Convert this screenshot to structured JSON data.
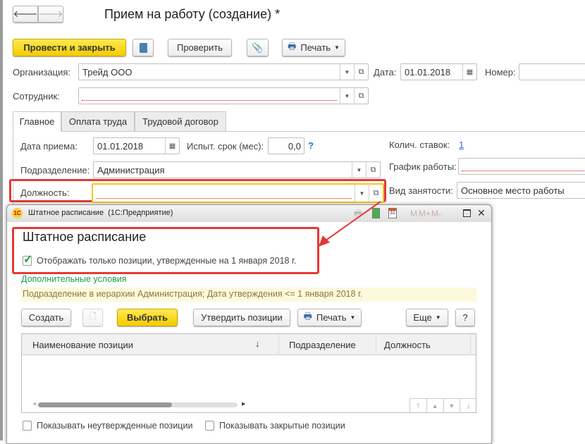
{
  "window": {
    "title": "Прием на работу (создание) *"
  },
  "toolbar": {
    "post_close": "Провести и закрыть",
    "check": "Проверить",
    "print": "Печать"
  },
  "form": {
    "org_label": "Организация:",
    "org_value": "Трейд ООО",
    "date_label": "Дата:",
    "date_value": "01.01.2018",
    "number_label": "Номер:",
    "number_value": "",
    "employee_label": "Сотрудник:",
    "employee_value": ""
  },
  "tabs": [
    "Главное",
    "Оплата труда",
    "Трудовой договор"
  ],
  "main": {
    "hire_date_label": "Дата приема:",
    "hire_date_value": "01.01.2018",
    "trial_label": "Испыт. срок (мес):",
    "trial_value": "0,0",
    "help": "?",
    "rates_label": "Колич. ставок:",
    "rates_value": "1",
    "dept_label": "Подразделение:",
    "dept_value": "Администрация",
    "schedule_label": "График работы:",
    "schedule_value": "",
    "position_label": "Должность:",
    "position_value": "",
    "employment_label": "Вид занятости:",
    "employment_value": "Основное место работы"
  },
  "popup": {
    "title": "Штатное расписание  (1С:Предприятие)",
    "toolbar_icons": [
      "M",
      "M+",
      "M-"
    ],
    "heading": "Штатное расписание",
    "only_approved_label": "Отображать только позиции, утвержденные на 1 января 2018 г.",
    "only_approved_checked": true,
    "extra_conditions": "Дополнительные условия",
    "filter_text": "Подразделение в иерархии Администрация; Дата утверждения <= 1 января 2018 г.",
    "buttons": {
      "create": "Создать",
      "select": "Выбрать",
      "approve": "Утвердить позиции",
      "print": "Печать",
      "more": "Еще",
      "help": "?"
    },
    "columns": [
      "Наименование позиции",
      "Подразделение",
      "Должность"
    ],
    "sort_indicator": "↓",
    "show_unapproved": "Показывать неутвержденные позиции",
    "show_closed": "Показывать закрытые позиции"
  },
  "colors": {
    "accent_yellow": "#f5d000",
    "highlight_red": "#e53935",
    "link_green": "#1a9e4a",
    "filter_bg": "#fdf9dc"
  }
}
